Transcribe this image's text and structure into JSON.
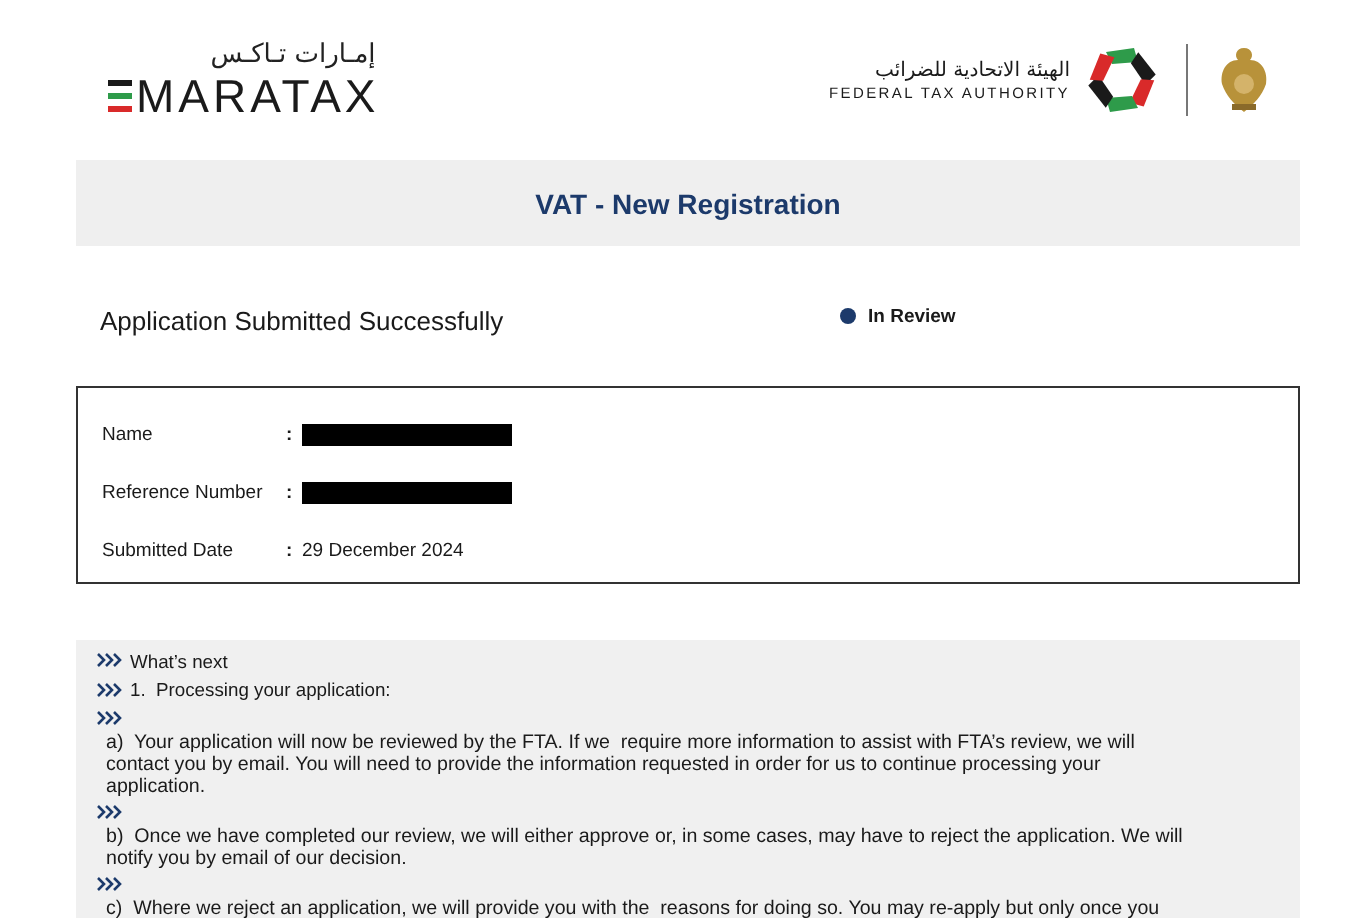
{
  "header": {
    "brand_arabic": "إمـارات تـاكـس",
    "brand_name": "MARATAX",
    "authority_arabic": "الهيئة الاتحادية للضرائب",
    "authority_name": "FEDERAL TAX AUTHORITY"
  },
  "page_title": "VAT - New Registration",
  "status": {
    "heading": "Application Submitted Successfully",
    "label": "In Review",
    "color": "#1c3a6b"
  },
  "details": [
    {
      "label": "Name",
      "separator": ":",
      "kind": "redacted"
    },
    {
      "label": "Reference Number",
      "separator": ":",
      "kind": "redacted"
    },
    {
      "label": "Submitted Date",
      "separator": ":",
      "kind": "text",
      "value": "29 December 2024"
    }
  ],
  "next_steps": [
    {
      "kind": "inline",
      "text": "What’s next"
    },
    {
      "kind": "inline",
      "text": "1.  Processing your application:"
    },
    {
      "kind": "block",
      "text": "a)  Your application will now be reviewed by the FTA. If we  require more information to assist with FTA’s review, we will contact you by email. You will need to provide the information requested in order for us to continue processing your application."
    },
    {
      "kind": "block",
      "text": "b)  Once we have completed our review, we will either approve or, in some cases, may have to reject the application. We will notify you by email of our decision."
    },
    {
      "kind": "block",
      "text": "c)  Where we reject an application, we will provide you with the  reasons for doing so. You may re-apply but only once you"
    }
  ]
}
